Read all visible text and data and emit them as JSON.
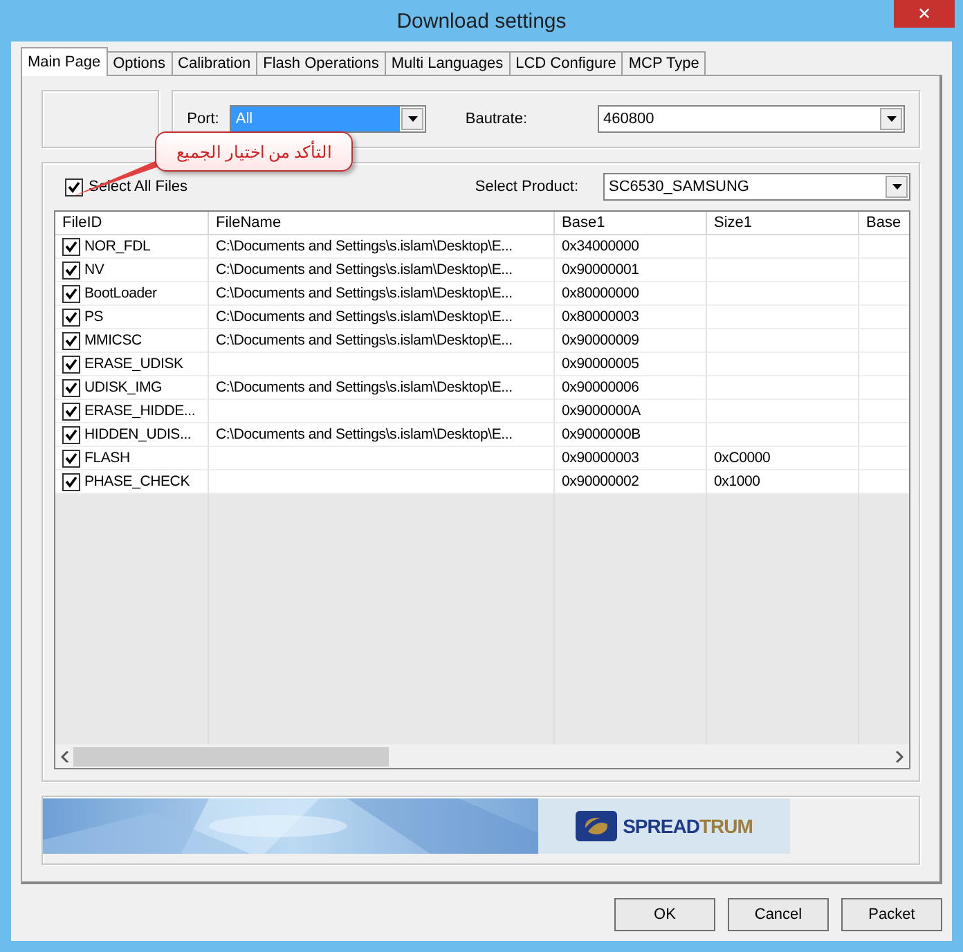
{
  "window": {
    "title": "Download settings",
    "close": "✕"
  },
  "tabs": [
    {
      "label": "Main Page",
      "selected": true
    },
    {
      "label": "Options",
      "selected": false
    },
    {
      "label": "Calibration",
      "selected": false
    },
    {
      "label": "Flash Operations",
      "selected": false
    },
    {
      "label": "Multi Languages",
      "selected": false
    },
    {
      "label": "LCD Configure",
      "selected": false
    },
    {
      "label": "MCP Type",
      "selected": false
    }
  ],
  "port": {
    "label": "Port:",
    "value": "All"
  },
  "baudrate": {
    "label": "Bautrate:",
    "value": "460800"
  },
  "select_all": {
    "label": "Select All Files",
    "checked": true
  },
  "product": {
    "label": "Select Product:",
    "value": "SC6530_SAMSUNG"
  },
  "callout": {
    "text": "التأكد من اختيار الجميع"
  },
  "table": {
    "columns": [
      "FileID",
      "FileName",
      "Base1",
      "Size1",
      "Base"
    ],
    "rows": [
      {
        "checked": true,
        "cells": [
          "NOR_FDL",
          "C:\\Documents and Settings\\s.islam\\Desktop\\E...",
          "0x34000000",
          ""
        ]
      },
      {
        "checked": true,
        "cells": [
          "NV",
          "C:\\Documents and Settings\\s.islam\\Desktop\\E...",
          "0x90000001",
          ""
        ]
      },
      {
        "checked": true,
        "cells": [
          "BootLoader",
          "C:\\Documents and Settings\\s.islam\\Desktop\\E...",
          "0x80000000",
          ""
        ]
      },
      {
        "checked": true,
        "cells": [
          "PS",
          "C:\\Documents and Settings\\s.islam\\Desktop\\E...",
          "0x80000003",
          ""
        ]
      },
      {
        "checked": true,
        "cells": [
          "MMICSC",
          "C:\\Documents and Settings\\s.islam\\Desktop\\E...",
          "0x90000009",
          ""
        ]
      },
      {
        "checked": true,
        "cells": [
          "ERASE_UDISK",
          "",
          "0x90000005",
          ""
        ]
      },
      {
        "checked": true,
        "cells": [
          "UDISK_IMG",
          "C:\\Documents and Settings\\s.islam\\Desktop\\E...",
          "0x90000006",
          ""
        ]
      },
      {
        "checked": true,
        "cells": [
          "ERASE_HIDDE...",
          "",
          "0x9000000A",
          ""
        ]
      },
      {
        "checked": true,
        "cells": [
          "HIDDEN_UDIS...",
          "C:\\Documents and Settings\\s.islam\\Desktop\\E...",
          "0x9000000B",
          ""
        ]
      },
      {
        "checked": true,
        "cells": [
          "FLASH",
          "",
          "0x90000003",
          "0xC0000"
        ]
      },
      {
        "checked": true,
        "cells": [
          "PHASE_CHECK",
          "",
          "0x90000002",
          "0x1000"
        ]
      }
    ]
  },
  "logo": {
    "parts": [
      "SPREAD",
      "TRUM"
    ]
  },
  "buttons": [
    "OK",
    "Cancel",
    "Packet"
  ]
}
